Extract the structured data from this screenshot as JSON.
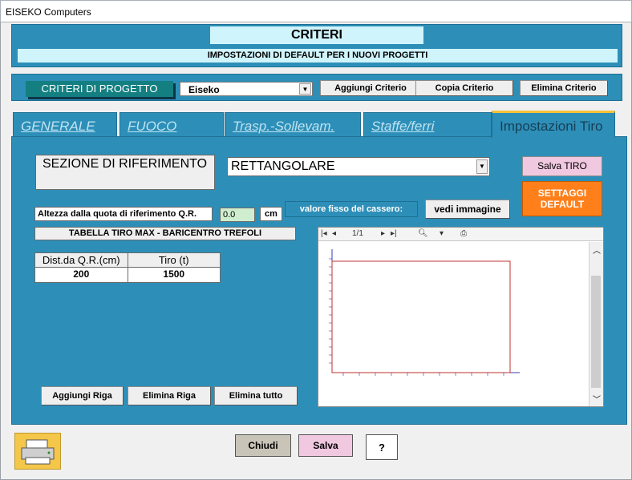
{
  "window": {
    "title": "EISEKO Computers"
  },
  "header": {
    "title": "CRITERI",
    "subtitle": "IMPOSTAZIONI DI DEFAULT PER I NUOVI PROGETTI"
  },
  "criteria_bar": {
    "label": "CRITERI DI PROGETTO",
    "selected": "Eiseko",
    "add_label": "Aggiungi Criterio",
    "copy_label": "Copia Criterio",
    "delete_label": "Elimina Criterio"
  },
  "tabs": [
    {
      "label": "GENERALE"
    },
    {
      "label": "FUOCO"
    },
    {
      "label": "Trasp.-Sollevam."
    },
    {
      "label": "Staffe/ferri"
    },
    {
      "label": "Impostazioni Tiro"
    }
  ],
  "form": {
    "sezione_label": "SEZIONE DI RIFERIMENTO",
    "sezione_value": "RETTANGOLARE",
    "altezza_label": "Altezza dalla quota di riferimento Q.R.",
    "altezza_value": "0.0",
    "unit": "cm",
    "valore_label": "valore fisso del cassero:",
    "vedi_label": "vedi immagine",
    "salva_tiro": "Salva TIRO",
    "settaggi_1": "SETTAGGI",
    "settaggi_2": "DEFAULT",
    "tabella_label": "TABELLA TIRO MAX - BARICENTRO TREFOLI"
  },
  "table": {
    "headers": [
      "Dist.da Q.R.(cm)",
      "Tiro (t)"
    ],
    "rows": [
      [
        "200",
        "1500"
      ]
    ]
  },
  "viewer": {
    "page": "1/1"
  },
  "grid_buttons": {
    "add": "Aggiungi Riga",
    "delete": "Elimina Riga",
    "delete_all": "Elimina tutto"
  },
  "footer": {
    "close": "Chiudi",
    "save": "Salva",
    "help": "?"
  },
  "colors": {
    "panel": "#2d8fb8",
    "accent_tab": "#f7c23a",
    "pink": "#f0c8e0",
    "orange": "#ff7f1a"
  }
}
